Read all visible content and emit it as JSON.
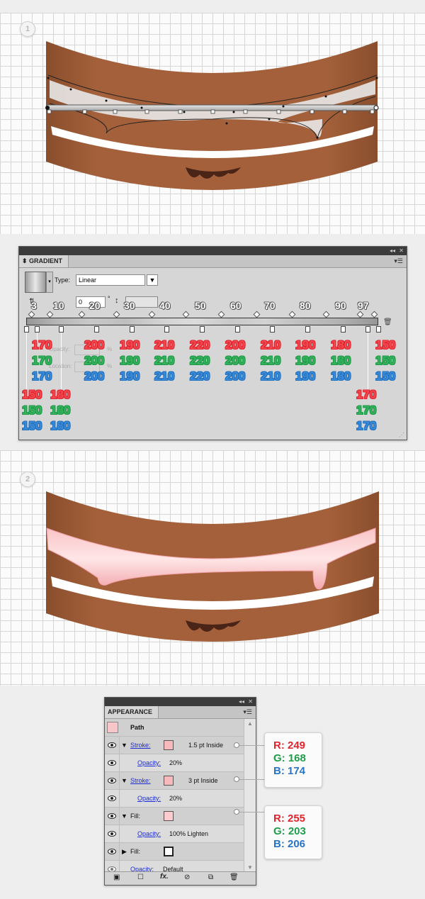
{
  "steps": [
    "1",
    "2"
  ],
  "gradient_panel": {
    "tab_title": "GRADIENT",
    "type_label": "Type:",
    "type_value": "Linear",
    "angle_value": "0",
    "angle_unit": "°",
    "opacity_label": "Opacity:",
    "location_label": "Location:",
    "percent": "%",
    "location_marks": [
      "3",
      "10",
      "20",
      "30",
      "40",
      "50",
      "60",
      "70",
      "80",
      "90",
      "97"
    ],
    "upper_columns": [
      {
        "r": "170",
        "g": "170",
        "b": "170"
      },
      {
        "r": "200",
        "g": "200",
        "b": "200"
      },
      {
        "r": "190",
        "g": "190",
        "b": "190"
      },
      {
        "r": "210",
        "g": "210",
        "b": "210"
      },
      {
        "r": "220",
        "g": "220",
        "b": "220"
      },
      {
        "r": "200",
        "g": "200",
        "b": "200"
      },
      {
        "r": "210",
        "g": "210",
        "b": "210"
      },
      {
        "r": "190",
        "g": "190",
        "b": "190"
      },
      {
        "r": "180",
        "g": "180",
        "b": "180"
      },
      {
        "r": "150",
        "g": "150",
        "b": "150"
      }
    ],
    "lower_left": [
      {
        "r": "150",
        "g": "150",
        "b": "150"
      },
      {
        "r": "180",
        "g": "180",
        "b": "180"
      }
    ],
    "lower_right": {
      "r": "170",
      "g": "170",
      "b": "170"
    }
  },
  "appearance_panel": {
    "tab_title": "APPEARANCE",
    "path_label": "Path",
    "rows": [
      {
        "label": "Stroke:",
        "value": "1.5 pt  Inside"
      },
      {
        "label": "Opacity:",
        "value": "20%"
      },
      {
        "label": "Stroke:",
        "value": "3 pt  Inside"
      },
      {
        "label": "Opacity:",
        "value": "20%"
      },
      {
        "label": "Fill:",
        "value": ""
      },
      {
        "label": "Opacity:",
        "value": "100% Lighten"
      },
      {
        "label": "Fill:",
        "value": ""
      },
      {
        "label": "Opacity:",
        "value": "Default"
      }
    ],
    "callouts": [
      {
        "r": "R: 249",
        "g": "G: 168",
        "b": "B: 174"
      },
      {
        "r": "R: 255",
        "g": "G: 203",
        "b": "B: 206"
      }
    ]
  },
  "colors": {
    "cake_brown": "#9c5a35",
    "cream_white": "#ffffff",
    "jam_pink": "#f8b9bc",
    "chocolate": "#4a2417"
  },
  "icons": [
    "step-badge-icon",
    "collapse-icon",
    "close-icon",
    "panel-menu-icon",
    "gradient-swatch",
    "dropdown-arrow-icon",
    "reverse-gradient-icon",
    "angle-icon",
    "aspect-ratio-icon",
    "trash-icon",
    "eye-icon",
    "expand-triangle-icon",
    "fx-icon",
    "clear-icon",
    "duplicate-icon",
    "add-new-effect-icon"
  ]
}
